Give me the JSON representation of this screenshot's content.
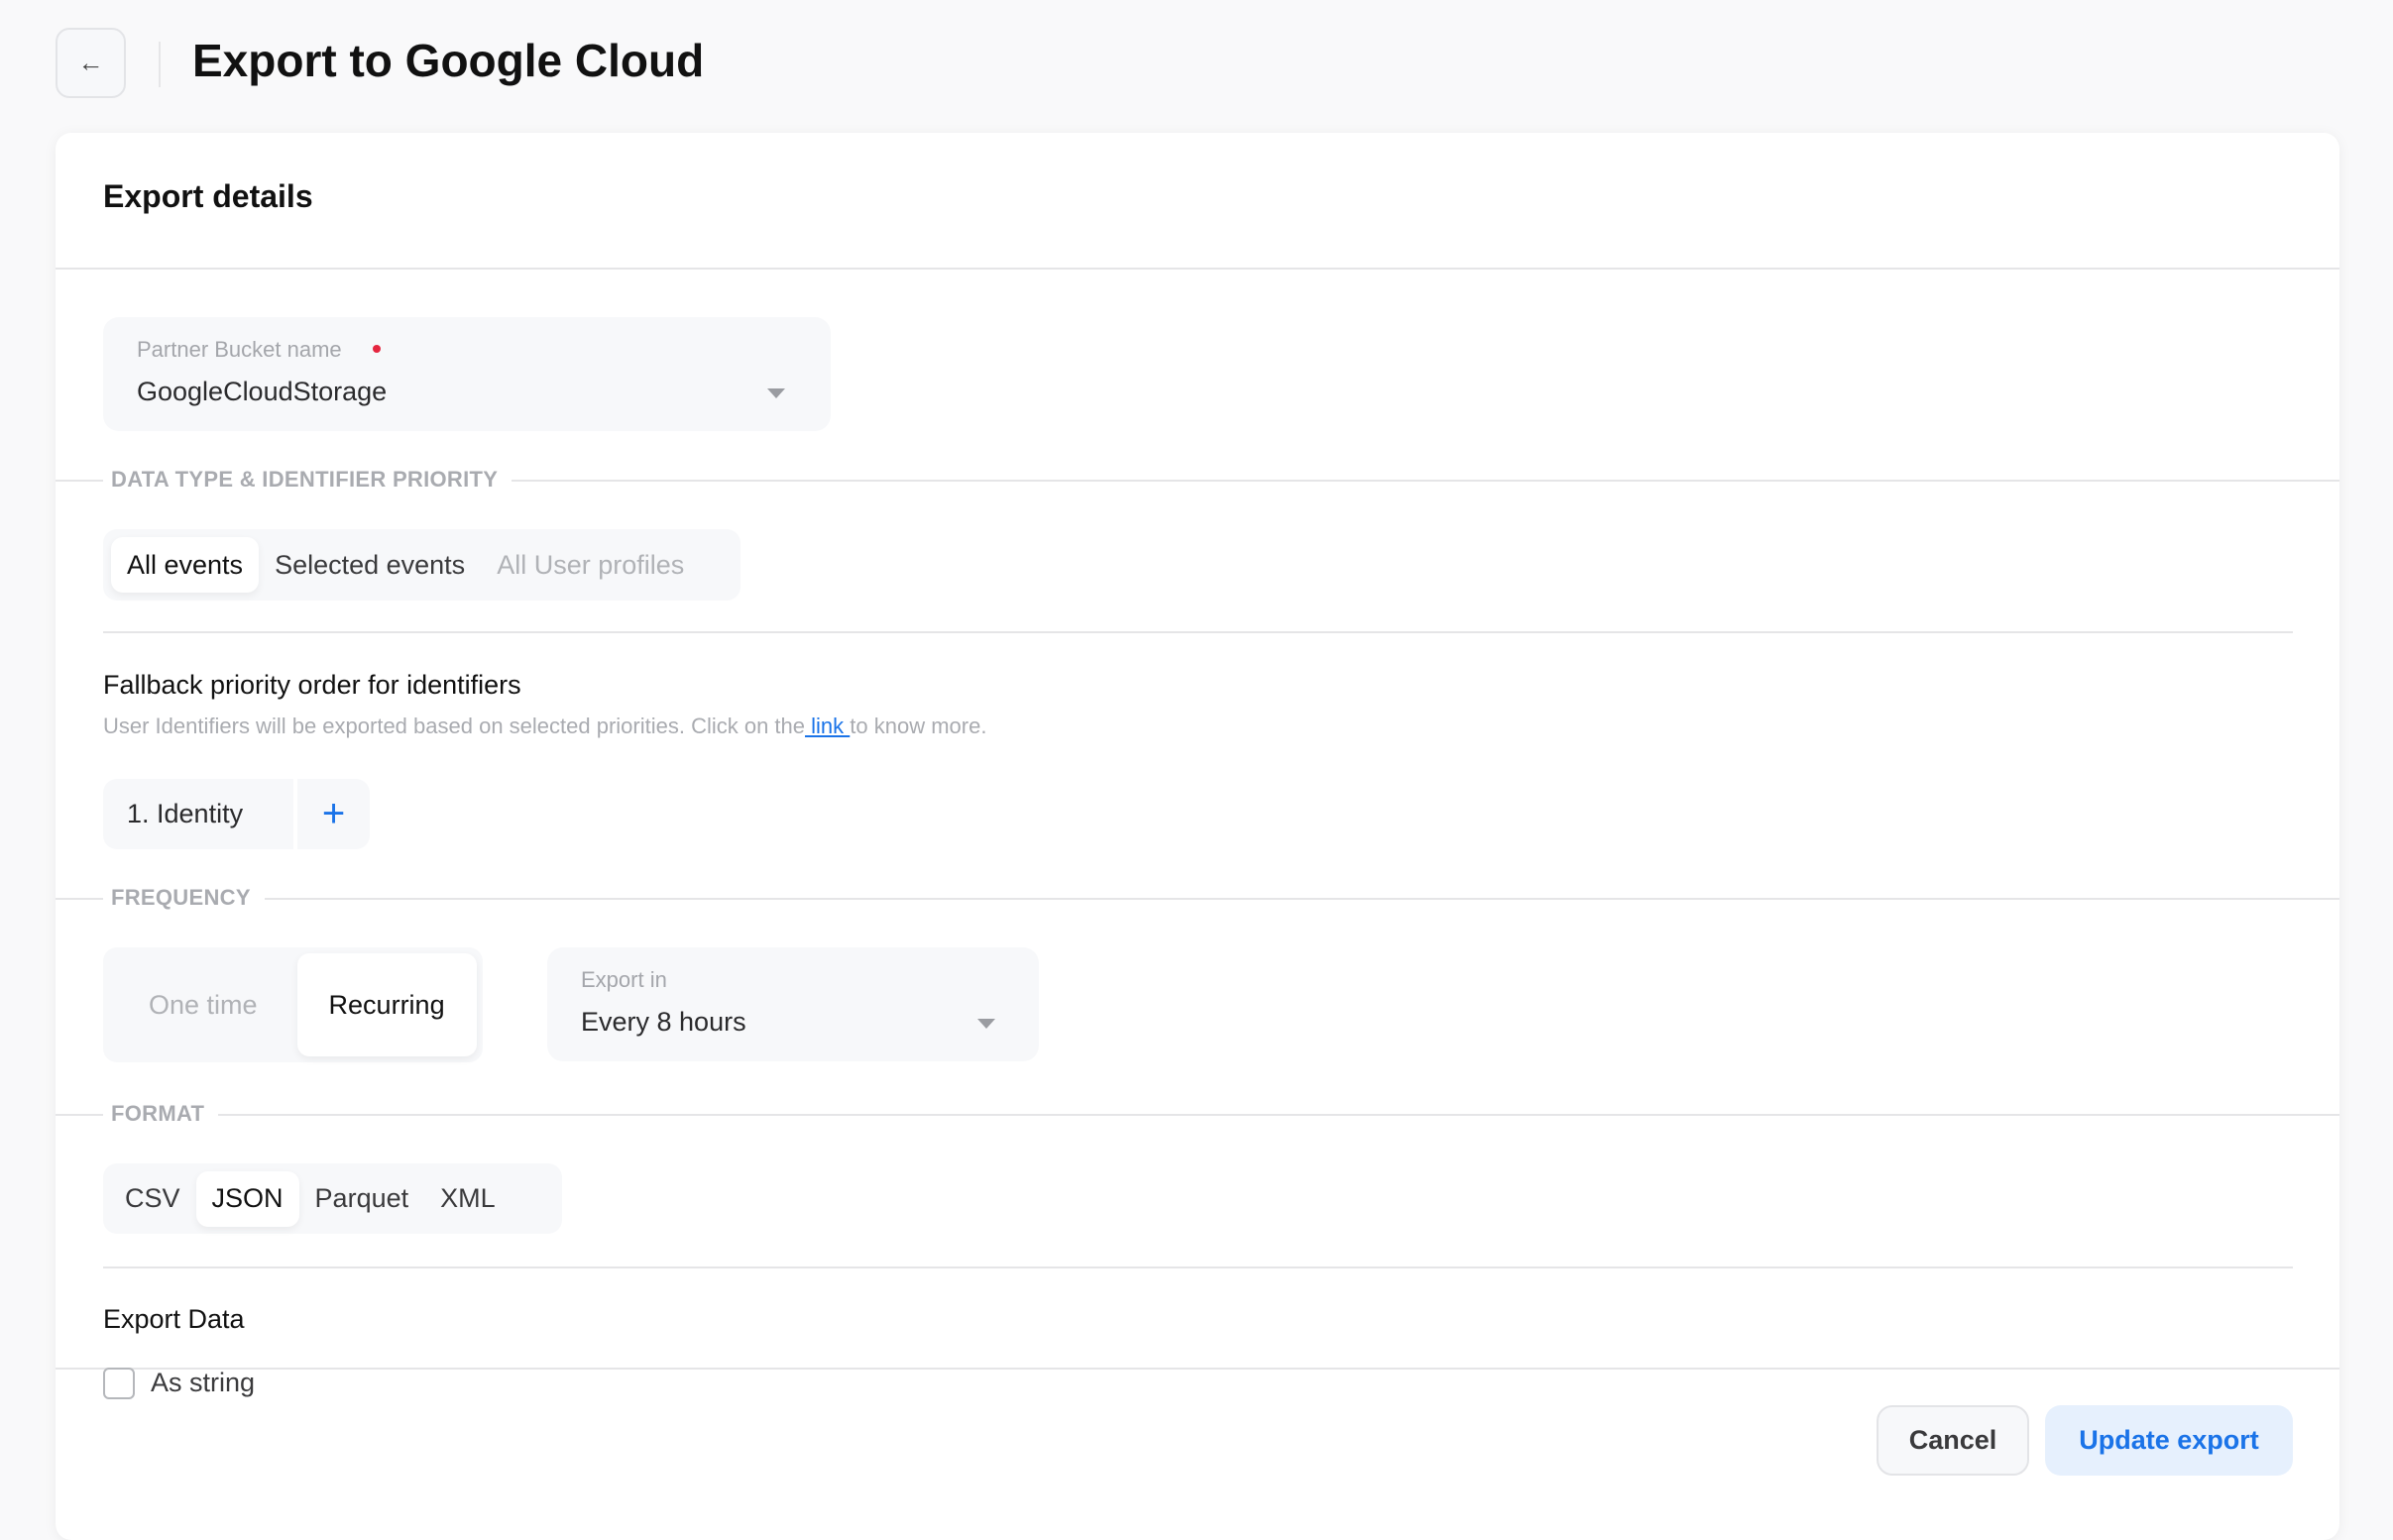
{
  "header": {
    "back_icon": "arrow-left-icon",
    "title": "Export to Google Cloud"
  },
  "card": {
    "title": "Export details"
  },
  "bucket": {
    "label": "Partner Bucket name",
    "required": true,
    "value": "GoogleCloudStorage"
  },
  "data_type": {
    "section": "DATA TYPE & IDENTIFIER PRIORITY",
    "options": [
      "All events",
      "Selected events",
      "All User profiles"
    ],
    "selected": "All events"
  },
  "fallback": {
    "title": "Fallback priority order for identifiers",
    "desc_before": "User Identifiers will be exported based on selected priorities. Click on the",
    "link": " link ",
    "desc_after": "to know more.",
    "identifiers": [
      "1. Identity"
    ],
    "add_icon": "plus-icon"
  },
  "frequency": {
    "section": "FREQUENCY",
    "options": [
      "One time",
      "Recurring"
    ],
    "selected": "Recurring",
    "export_in_label": "Export in",
    "export_in_value": "Every 8 hours"
  },
  "format": {
    "section": "FORMAT",
    "options": [
      "CSV",
      "JSON",
      "Parquet",
      "XML"
    ],
    "selected": "JSON"
  },
  "export_data": {
    "title": "Export Data",
    "as_string_label": "As string",
    "as_string_checked": false
  },
  "footer": {
    "cancel": "Cancel",
    "update": "Update export"
  },
  "colors": {
    "accent": "#1a73e8",
    "required": "#e5263f",
    "primary_bg": "#e6f0fd"
  }
}
